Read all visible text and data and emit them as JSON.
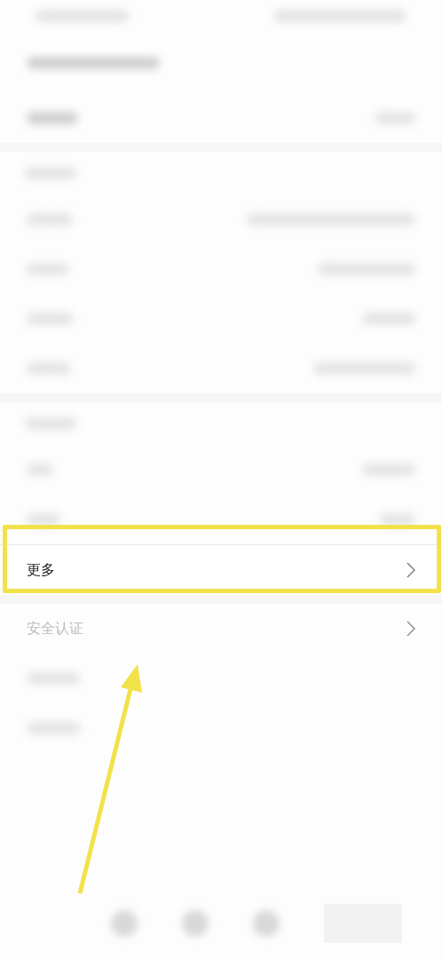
{
  "highlighted_row": {
    "label": "更多"
  },
  "next_row": {
    "label": "安全认证"
  }
}
